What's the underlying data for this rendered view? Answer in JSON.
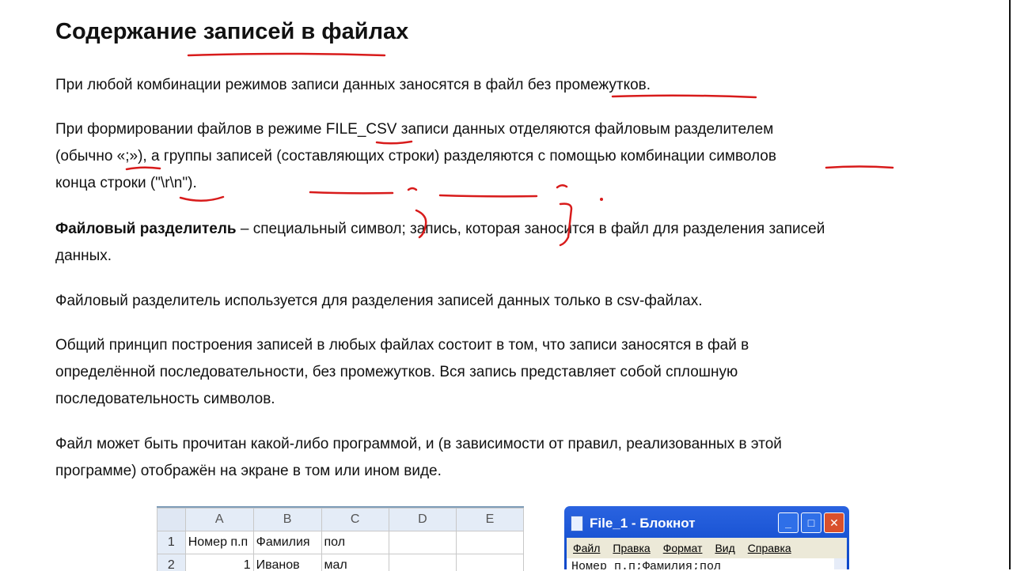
{
  "title": "Содержание записей в файлах",
  "paragraphs": {
    "p1": {
      "text": "При любой комбинации режимов записи данных заносятся в файл без промежутков."
    },
    "p2": {
      "part1": "При формировании файлов в режиме FILE_CSV записи данных отделяются файловым разделителем",
      "part2": "(обычно «;»), а группы записей (составляющих строки) разделяются с помощью комбинации символов",
      "part3": "конца строки (\"\\r\\n\")."
    },
    "p3": {
      "bold": "Файловый разделитель",
      "rest": " – специальный символ; запись, которая заносится в файл для разделения записей",
      "line2": "данных."
    },
    "p4": {
      "text": "Файловый разделитель используется для разделения записей данных только в csv-файлах."
    },
    "p5": {
      "line1": "Общий принцип построения записей в любых файлах состоит в том, что записи заносятся в фай в",
      "line2": "определённой последовательности, без промежутков. Вся запись представляет собой сплошную",
      "line3": "последовательность символов."
    },
    "p6": {
      "line1": "Файл может быть прочитан какой-либо программой, и (в зависимости от правил, реализованных в этой",
      "line2": "программе) отображён на экране в том или ином виде."
    }
  },
  "spreadsheet": {
    "columns": [
      "A",
      "B",
      "C",
      "D",
      "E"
    ],
    "rows": [
      {
        "num": "1",
        "cells": [
          "Номер п.п",
          "Фамилия",
          "пол",
          "",
          ""
        ]
      },
      {
        "num": "2",
        "cells": [
          "1",
          "Иванов",
          "мал",
          "",
          ""
        ]
      }
    ]
  },
  "notepad": {
    "title": "File_1 - Блокнот",
    "menu": [
      "Файл",
      "Правка",
      "Формат",
      "Вид",
      "Справка"
    ],
    "content": "Номер п.п;Фамилия;пол",
    "buttons": {
      "minimize": "_",
      "maximize": "□",
      "close": "✕"
    }
  },
  "colors": {
    "annotation": "#d81b1b",
    "notepad_title": "#0a46c8"
  }
}
